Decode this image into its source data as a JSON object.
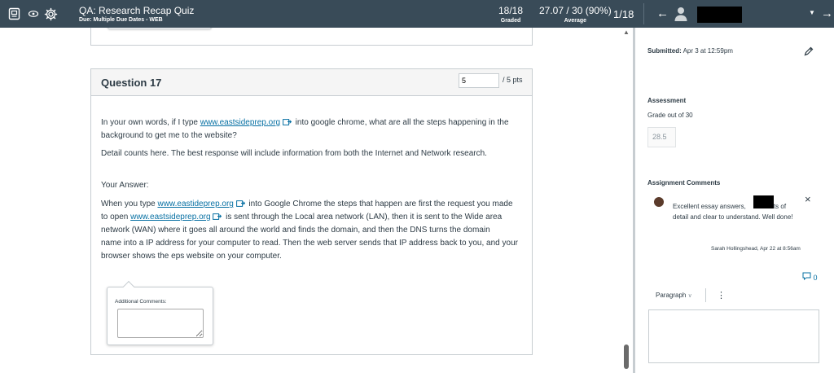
{
  "topbar": {
    "title": "QA: Research Recap Quiz",
    "subtitle": "Due: Multiple Due Dates - WEB",
    "graded_value": "18/18",
    "graded_label": "Graded",
    "average_value": "27.07 / 30 (90%)",
    "average_label": "Average",
    "student_count": "1/18",
    "icons": [
      "speedgrader-icon",
      "eye-icon",
      "gear-icon",
      "arrow-left-icon",
      "user-icon",
      "caret-down-icon",
      "arrow-right-icon"
    ]
  },
  "question": {
    "title": "Question 17",
    "points_value": "5",
    "points_label": "/ 5 pts",
    "prompt_line1_pre": "In your own words, if I type ",
    "prompt_link": "www.eastsideprep.org",
    "prompt_line1_post": " into google chrome, what are all the steps happening in the",
    "prompt_line2": "background to get me to the website?",
    "prompt_detail": "Detail counts here.  The best response will include information from both the Internet and Network research.",
    "your_answer_label": "Your Answer:",
    "answer_pre1": "When you type ",
    "answer_link1": "www.eastideprep.org",
    "answer_mid1": " into Google Chrome the steps that happen are first the request you made",
    "answer_pre2": "to open ",
    "answer_link2": "www.eastsideprep.org",
    "answer_mid2": " is sent through the Local area network (LAN), then it is sent to the Wide area",
    "answer_line3": "network (WAN) where it goes all around the world and finds the domain, and then the DNS turns the domain",
    "answer_line4": "name into a IP address for your computer to read. Then the web server sends that IP address back to you, and your",
    "answer_line5": "browser shows the eps website on your computer.",
    "additional_comments_label": "Additional Comments:"
  },
  "sidebar": {
    "submitted_label": "Submitted:",
    "submitted_value": " Apr 3 at 12:59pm",
    "assessment_title": "Assessment",
    "grade_out_of": "Grade out of 30",
    "grade_value": "28.5",
    "comments_title": "Assignment Comments",
    "comment_pre": "Excellent essay answers,",
    "comment_post": "Lots of detail and clear to understand. Well done!",
    "comment_meta": "Sarah Hollingshead, Apr 22 at 8:56am",
    "comment_count": "0",
    "paragraph_label": "Paragraph"
  },
  "colors": {
    "topbar_bg": "#394b58",
    "link": "#0770a3",
    "text": "#2d3b45",
    "border": "#c7cdd1"
  }
}
